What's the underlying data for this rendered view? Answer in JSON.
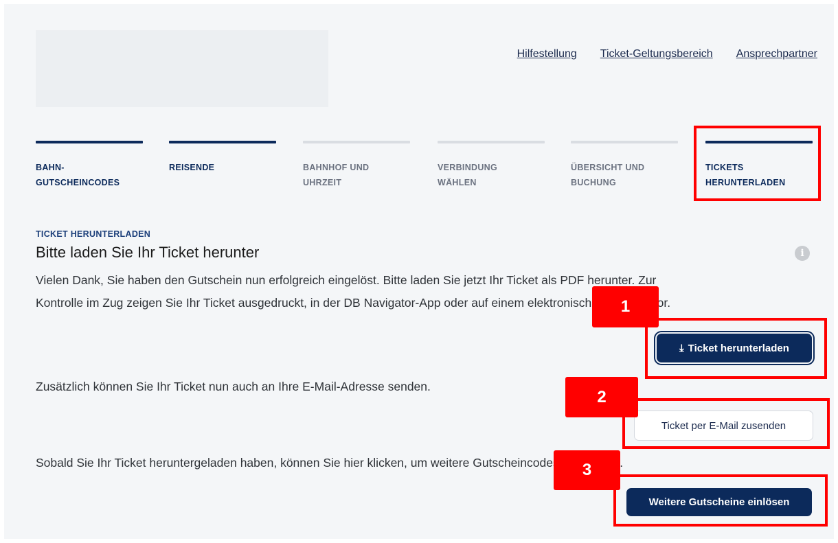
{
  "header": {
    "links": [
      "Hilfestellung",
      "Ticket-Geltungsbereich",
      "Ansprechpartner"
    ]
  },
  "steps": [
    {
      "label": "BAHN-\nGUTSCHEINCODES",
      "done": true
    },
    {
      "label": "REISENDE",
      "done": true
    },
    {
      "label": "BAHNHOF UND\nUHRZEIT",
      "done": false
    },
    {
      "label": "VERBINDUNG\nWÄHLEN",
      "done": false
    },
    {
      "label": "ÜBERSICHT UND\nBUCHUNG",
      "done": false
    },
    {
      "label": "TICKETS\nHERUNTERLADEN",
      "done": true
    }
  ],
  "section": {
    "eyebrow": "TICKET HERUNTERLADEN",
    "title": "Bitte laden Sie Ihr Ticket herunter",
    "info_icon": "info-icon",
    "para1_line1": "Vielen Dank, Sie haben den Gutschein nun erfolgreich eingelöst. Bitte laden Sie jetzt Ihr Ticket als PDF herunter. Zur",
    "para1_line2": "Kontrolle im Zug zeigen Sie Ihr Ticket ausgedruckt, in der DB Navigator-App oder auf einem elektronischen Display vor.",
    "para2": "Zusätzlich können Sie Ihr Ticket nun auch an Ihre E-Mail-Adresse senden.",
    "para3": "Sobald Sie Ihr Ticket heruntergeladen haben, können Sie hier klicken, um weitere Gutscheincodes einzulösen."
  },
  "buttons": {
    "download_icon": "download-icon",
    "download_glyph": "⤓",
    "download": "Ticket herunterladen",
    "email": "Ticket per E-Mail zusenden",
    "more": "Weitere Gutscheine einlösen"
  },
  "annotations": [
    "1",
    "2",
    "3"
  ],
  "colors": {
    "accent": "#0c2a5b",
    "highlight": "#ff0000"
  }
}
